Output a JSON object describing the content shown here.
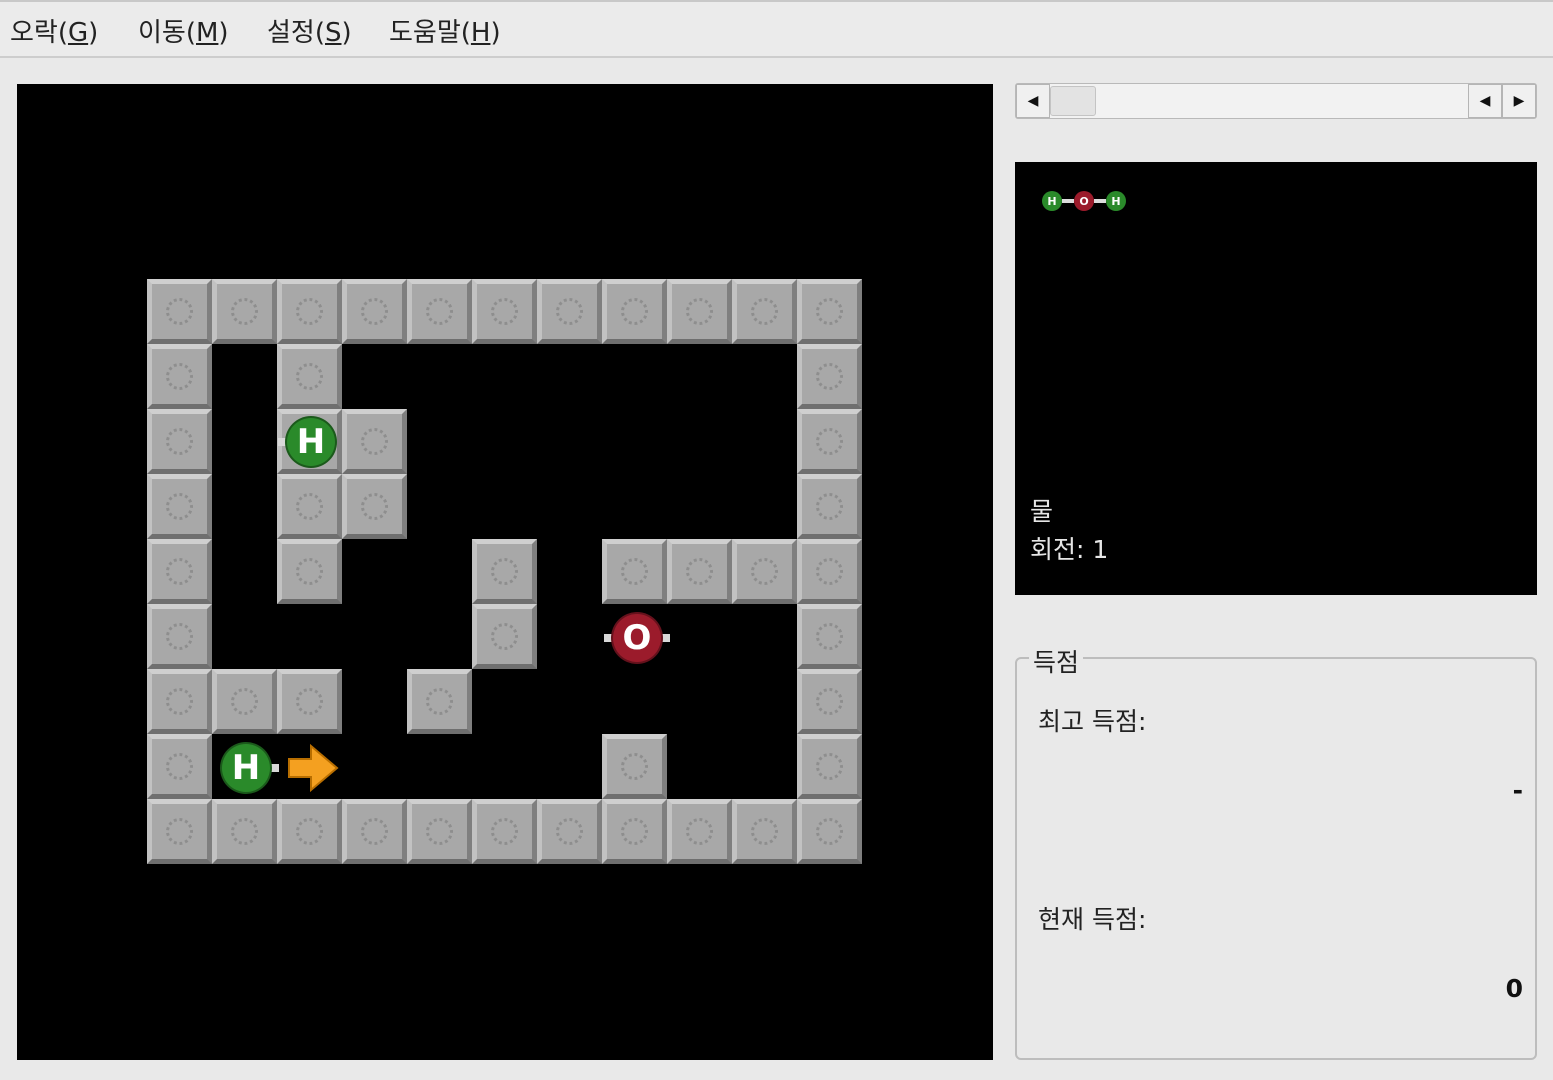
{
  "menu": {
    "game": {
      "text": "오락(",
      "key": "G",
      "close": ")"
    },
    "move": {
      "text": "이동(",
      "key": "M",
      "close": ")"
    },
    "settings": {
      "text": "설정(",
      "key": "S",
      "close": ")"
    },
    "help": {
      "text": "도움말(",
      "key": "H",
      "close": ")"
    }
  },
  "board": {
    "atoms": {
      "h1": "H",
      "o": "O",
      "h2": "H"
    },
    "colors": {
      "hydrogen": "#2a8a2a",
      "oxygen": "#9b1b2b",
      "arrow": "#f4a020",
      "background": "#000000"
    }
  },
  "scrollbar": {
    "left_arrow": "◀",
    "right_arrow_a": "◀",
    "right_arrow_b": "▶"
  },
  "preview": {
    "molecule": [
      "H",
      "O",
      "H"
    ],
    "name": "물",
    "moves_label": "회전: 1"
  },
  "score": {
    "legend": "득점",
    "high_label": "최고 득점:",
    "high_value": "-",
    "current_label": "현재 득점:",
    "current_value": "0"
  }
}
